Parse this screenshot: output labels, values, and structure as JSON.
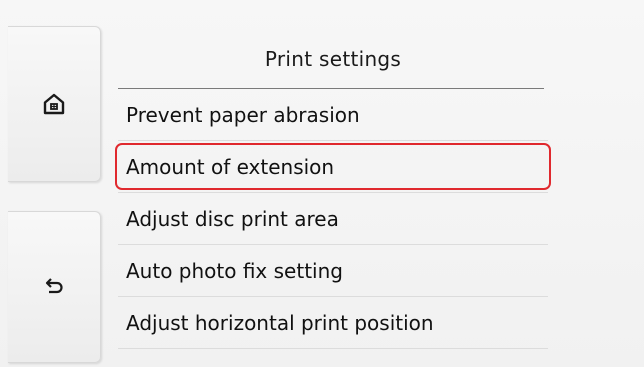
{
  "sidebar": {
    "home_icon": "home-icon",
    "back_icon": "back-arrow-icon"
  },
  "panel": {
    "title": "Print settings",
    "items": [
      {
        "label": "Prevent paper abrasion",
        "selected": false
      },
      {
        "label": "Amount of extension",
        "selected": true
      },
      {
        "label": "Adjust disc print area",
        "selected": false
      },
      {
        "label": "Auto photo fix setting",
        "selected": false
      },
      {
        "label": "Adjust horizontal print position",
        "selected": false
      }
    ]
  },
  "colors": {
    "highlight": "#e0292e"
  }
}
